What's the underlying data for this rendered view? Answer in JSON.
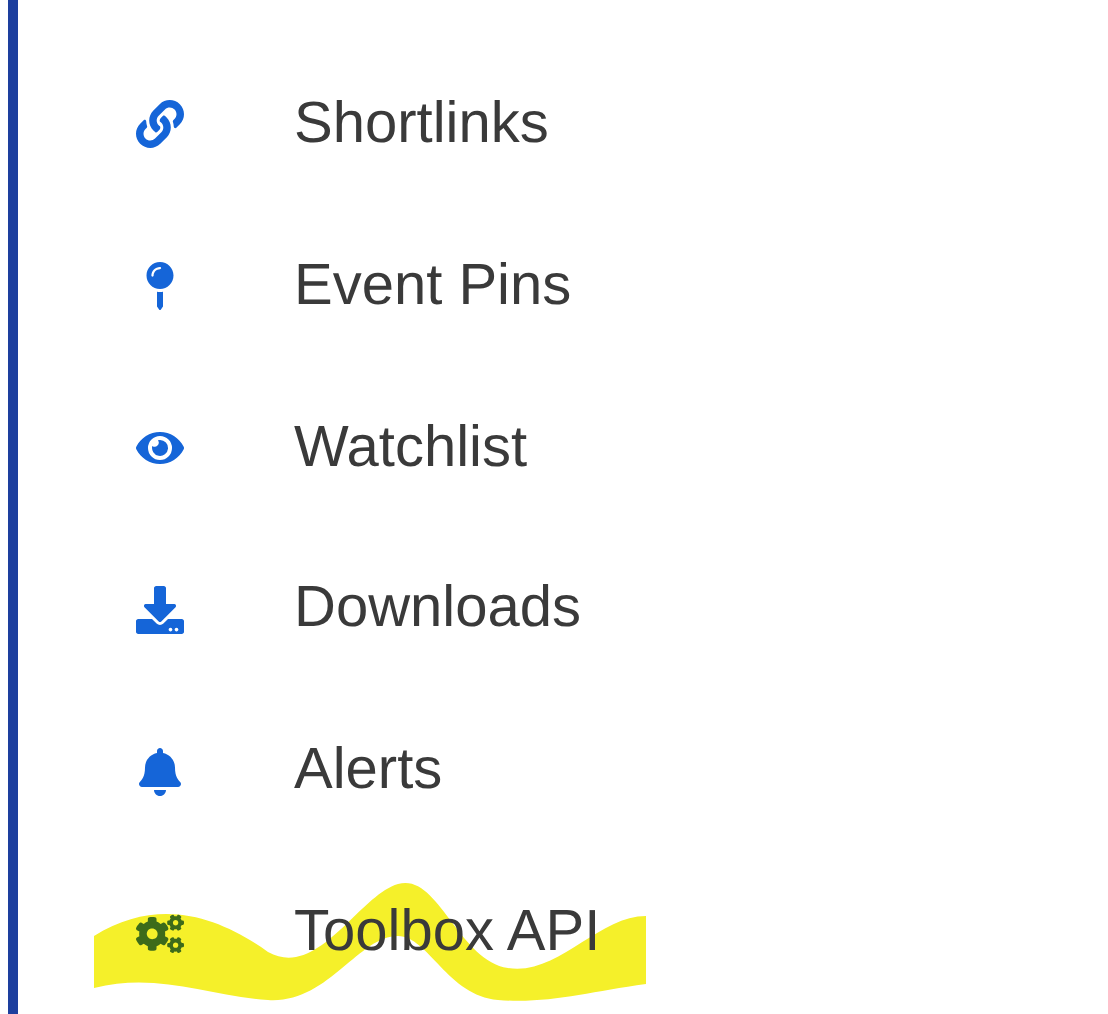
{
  "menu": {
    "items": [
      {
        "label": "Shortlinks",
        "highlighted": false
      },
      {
        "label": "Event Pins",
        "highlighted": false
      },
      {
        "label": "Watchlist",
        "highlighted": false
      },
      {
        "label": "Downloads",
        "highlighted": false
      },
      {
        "label": "Alerts",
        "highlighted": false
      },
      {
        "label": "Toolbox API",
        "highlighted": true
      }
    ]
  }
}
